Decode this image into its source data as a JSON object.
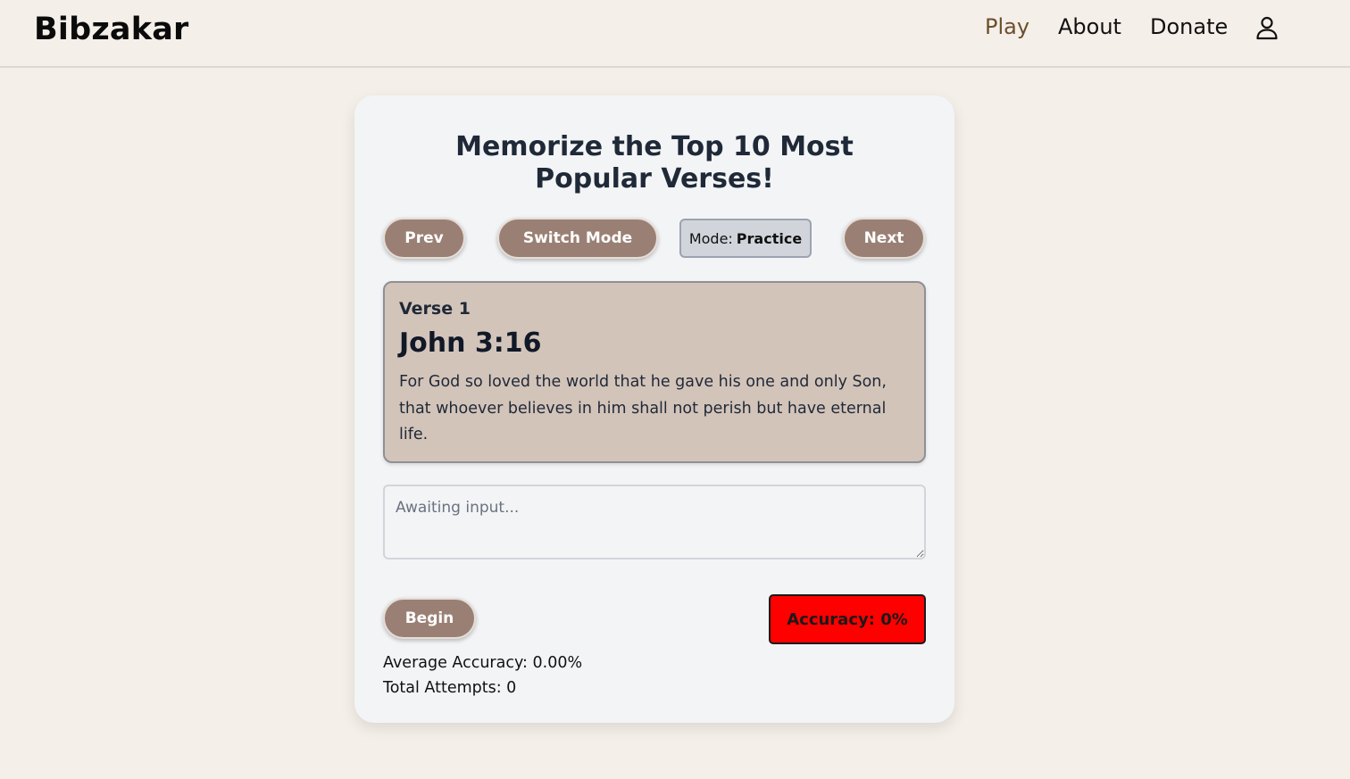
{
  "header": {
    "brand": "Bibzakar",
    "nav": {
      "play": "Play",
      "about": "About",
      "donate": "Donate"
    },
    "account_icon": "user-icon"
  },
  "card": {
    "title": "Memorize the Top 10 Most Popular Verses!",
    "buttons": {
      "prev": "Prev",
      "switch_mode": "Switch Mode",
      "next": "Next",
      "begin": "Begin"
    },
    "mode": {
      "label": "Mode:",
      "value": "Practice"
    },
    "verse": {
      "number": "Verse 1",
      "reference": "John 3:16",
      "text": "For God so loved the world that he gave his one and only Son, that whoever believes in him shall not perish but have eternal life."
    },
    "input": {
      "value": "",
      "placeholder": "Awaiting input..."
    },
    "accuracy": {
      "text": "Accuracy: 0%",
      "color": "#ff0000"
    },
    "stats": {
      "average_accuracy": "Average Accuracy: 0.00%",
      "total_attempts": "Total Attempts: 0"
    }
  },
  "colors": {
    "background": "#f5efe9",
    "card": "#f3f4f6",
    "button": "#9a8074",
    "verse_box": "#d3c4ba",
    "nav_active": "#6b4f2c"
  }
}
